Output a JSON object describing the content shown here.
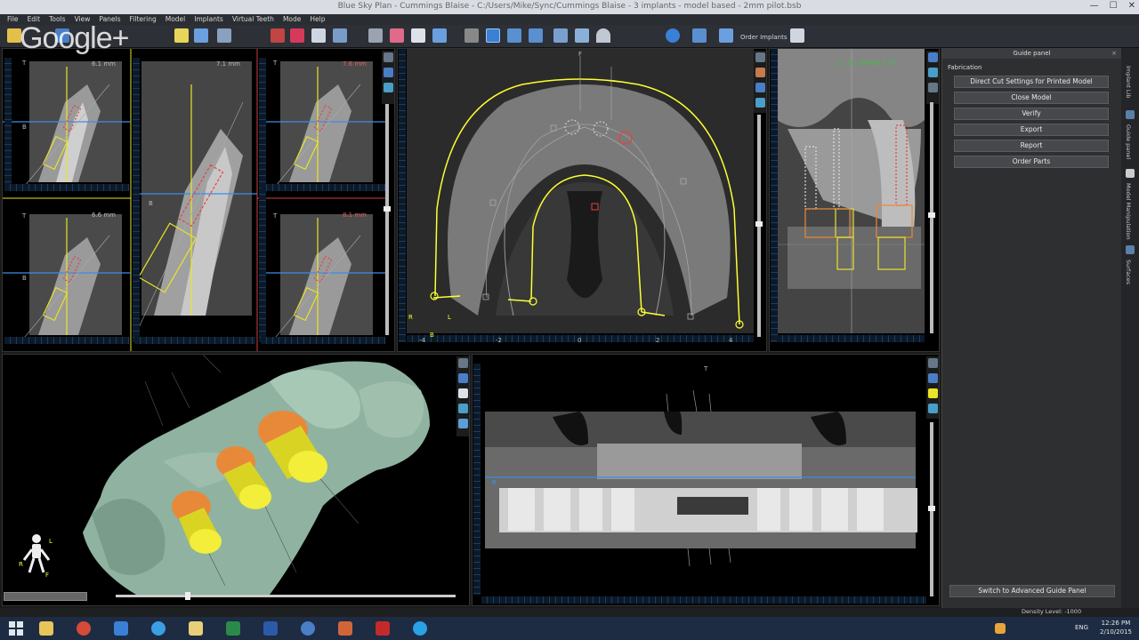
{
  "window": {
    "title": "Blue Sky Plan - Cummings Blaise - C:/Users/Mike/Sync/Cummings Blaise - 3 implants - model based - 2mm pilot.bsb",
    "controls": [
      "—",
      "☐",
      "✕"
    ]
  },
  "menu": [
    "File",
    "Edit",
    "Tools",
    "View",
    "Panels",
    "Filtering",
    "Model",
    "Implants",
    "Virtual Teeth",
    "Mode",
    "Help"
  ],
  "toolbar": {
    "order_label": "Order Implants"
  },
  "overlay": {
    "google_logo": "Google+"
  },
  "views": {
    "cross_sections": [
      {
        "id": "cs1",
        "measure": "6.1 mm"
      },
      {
        "id": "cs2",
        "measure": "7.1 mm"
      },
      {
        "id": "cs3",
        "measure": "7.6 mm"
      },
      {
        "id": "cs4",
        "measure": "6.6 mm"
      },
      {
        "id": "cs5",
        "measure": "8.1 mm"
      }
    ],
    "axial": {
      "marker_f": "F",
      "marker_b": "B",
      "marker_r": "R",
      "marker_l": "L",
      "x_ticks": [
        "-4",
        "-2",
        "0",
        "2",
        "4"
      ]
    },
    "sagittal": {
      "readout": "3, 10, ID43513, 0°"
    },
    "panoramic": {
      "marker_t": "T",
      "marker_b": "B"
    },
    "model_3d": {
      "orient_r": "R",
      "orient_l": "L",
      "orient_f": "F"
    },
    "side_ticks": [
      "2",
      "1",
      "0",
      "-1",
      "-2"
    ],
    "cs_letters": [
      "T",
      "B"
    ]
  },
  "guide_panel": {
    "title": "Guide panel",
    "close": "×",
    "section": "Fabrication",
    "buttons": [
      "Direct Cut Settings for Printed Model",
      "Close Model",
      "Verify",
      "Export",
      "Report",
      "Order Parts"
    ],
    "switch_button": "Switch to Advanced Guide Panel"
  },
  "side_tabs": [
    "Implant Lib",
    "Guide panel",
    "Model Manipulation",
    "Surfaces"
  ],
  "status": {
    "density": "Density Level: -1000"
  },
  "taskbar": {
    "tray_lang": "ENG",
    "clock_time": "12:26 PM",
    "clock_date": "2/10/2015"
  },
  "colors": {
    "implant_orange": "#e8893a",
    "implant_yellow": "#e9e428",
    "guide_yellow": "#ffff33",
    "accent_blue": "#3a8ee6",
    "model_green": "#8fb3a0"
  }
}
